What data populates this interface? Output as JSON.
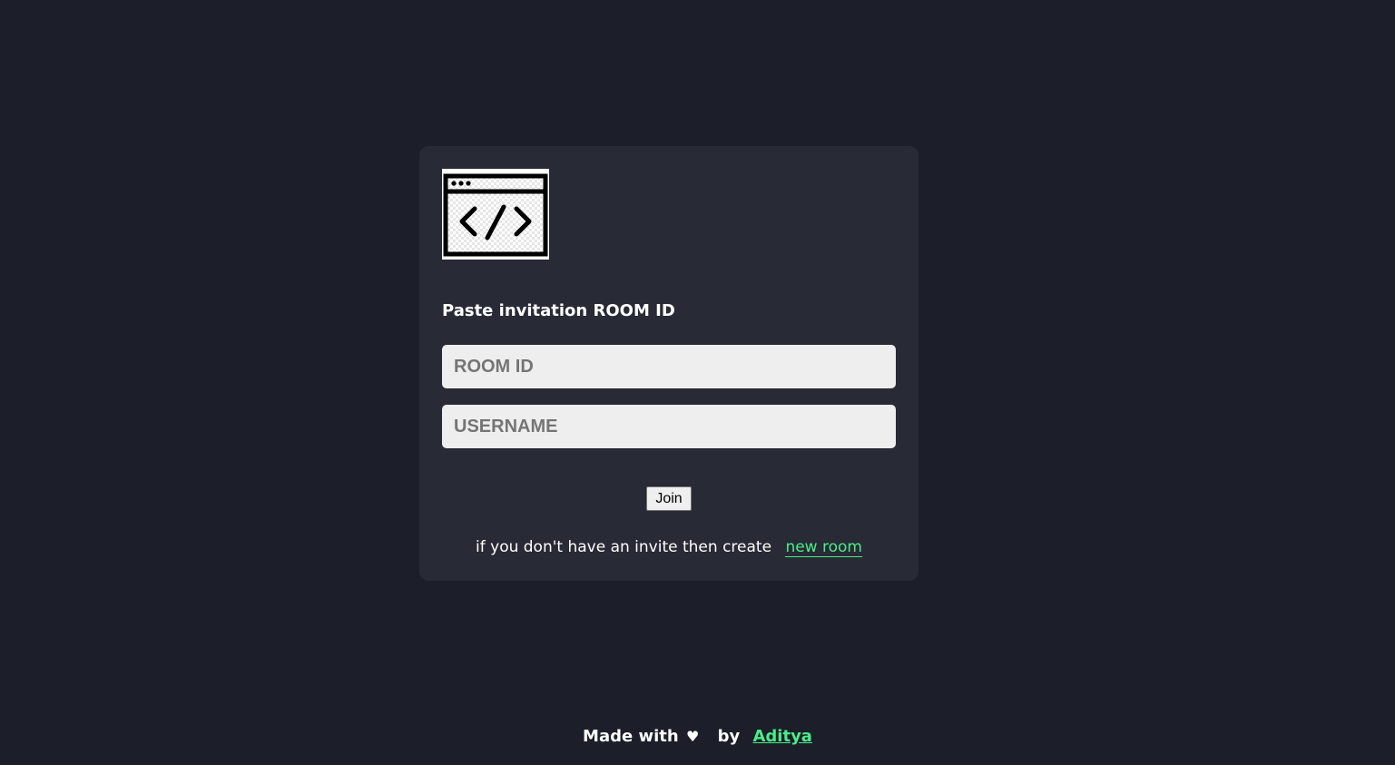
{
  "logo": {
    "icon": "code-window-icon"
  },
  "form": {
    "heading": "Paste invitation ROOM ID",
    "room_id": {
      "value": "",
      "placeholder": "ROOM ID"
    },
    "username": {
      "value": "",
      "placeholder": "USERNAME"
    },
    "join_label": "Join",
    "invite_text": "if you don't have an invite then create",
    "new_room_link": "new room"
  },
  "footer": {
    "made_with": "Made with",
    "heart_icon": "heart-icon",
    "by": "by",
    "author": "Aditya"
  },
  "colors": {
    "background": "#1c1e29",
    "card": "#282a36",
    "accent": "#4aed88",
    "input_bg": "#eeeeee"
  }
}
